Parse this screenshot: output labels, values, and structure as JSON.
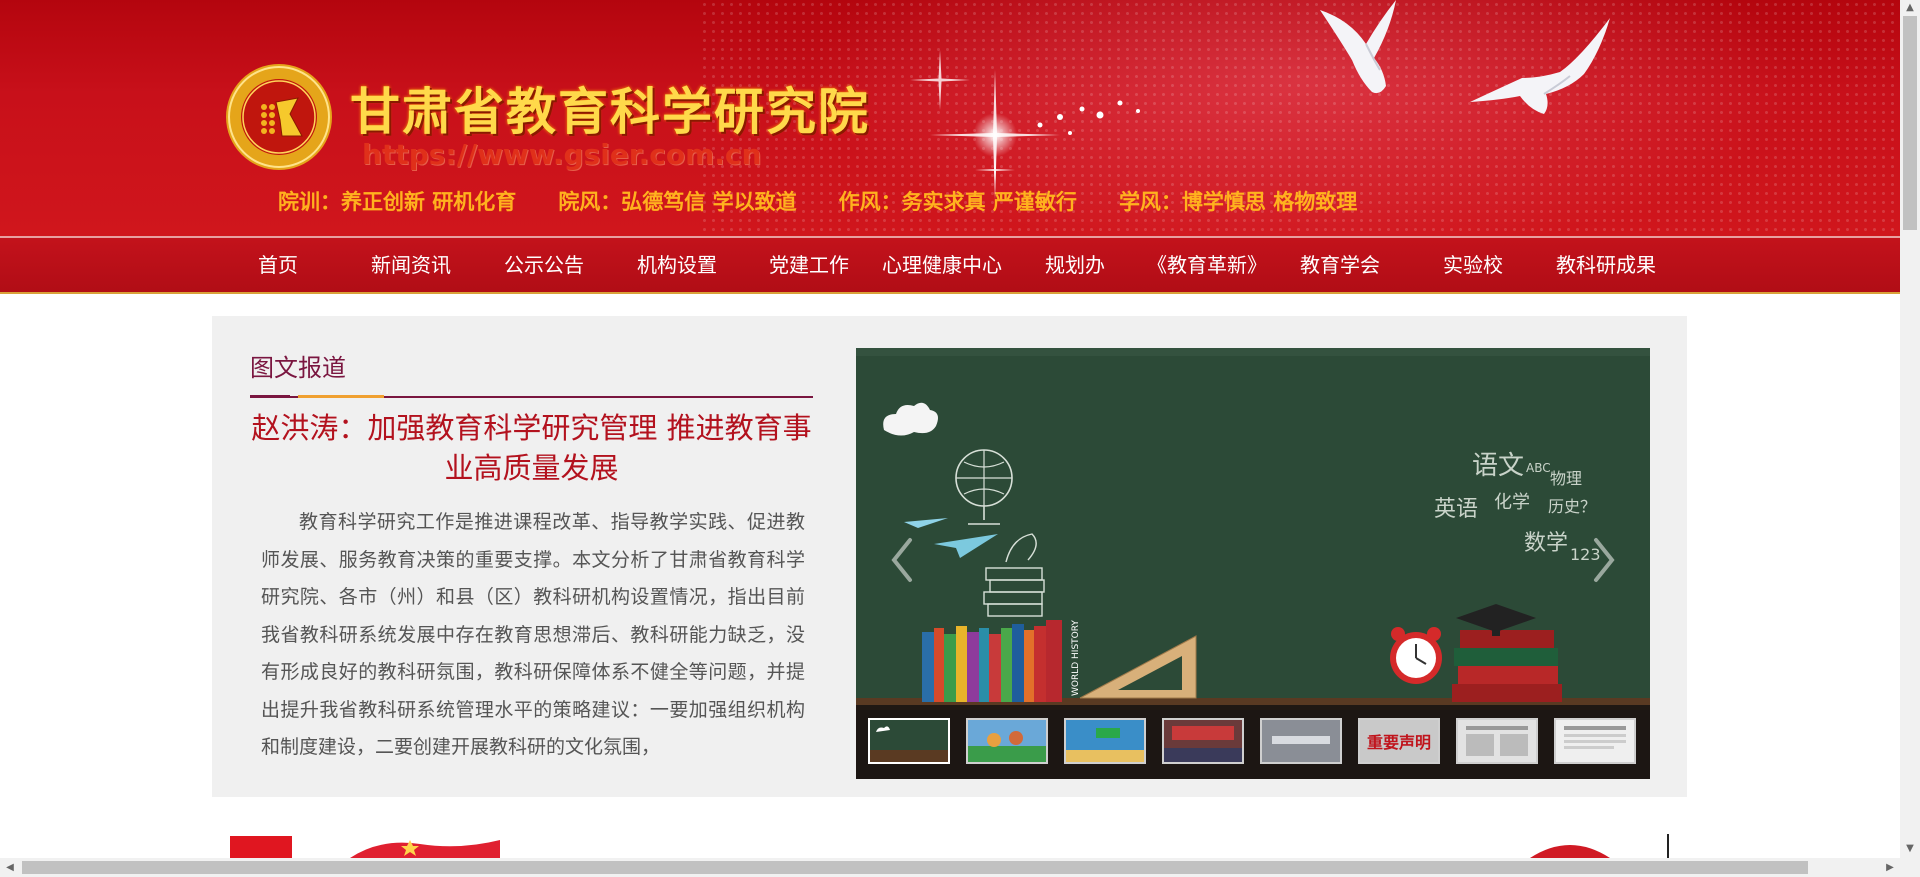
{
  "header": {
    "site_title": "甘肃省教育科学研究院",
    "site_url": "https://www.gsier.com.cn",
    "mottos": [
      "院训：养正创新  研机化育",
      "院风：弘德笃信  学以致道",
      "作风：务实求真  严谨敏行",
      "学风：博学慎思   格物致理"
    ],
    "colors": {
      "banner": "#c8101a",
      "title": "#ffd94a",
      "motto": "#ffb21e"
    }
  },
  "nav": {
    "items": [
      "首页",
      "新闻资讯",
      "公示公告",
      "机构设置",
      "党建工作",
      "心理健康中心",
      "规划办",
      "《教育革新》",
      "教育学会",
      "实验校",
      "教科研成果"
    ]
  },
  "feature": {
    "section_title": "图文报道",
    "article_title": "赵洪涛：加强教育科学研究管理 推进教育事业高质量发展",
    "article_body": "教育科学研究工作是推进课程改革、指导教学实践、促进教师发展、服务教育决策的重要支撑。本文分析了甘肃省教育科学研究院、各市（州）和县（区）教科研机构设置情况，指出目前我省教科研系统发展中存在教育思想滞后、教科研能力缺乏，没有形成良好的教科研氛围，教科研保障体系不健全等问题，并提出提升我省教科研系统管理水平的策略建议：一要加强组织机构和制度建设，二要创建开展教科研的文化氛围，",
    "slider": {
      "blackboard_words": [
        "语文",
        "英语",
        "化学",
        "数学",
        "历史？",
        "物理",
        "123",
        "ABC",
        "WORLD HISTORY"
      ],
      "thumb_label_notice": "重要声明",
      "thumb_count": 8,
      "active_index": 0
    }
  },
  "icons": {
    "prev": "chevron-left-icon",
    "next": "chevron-right-icon",
    "logo": "institute-seal-logo"
  }
}
